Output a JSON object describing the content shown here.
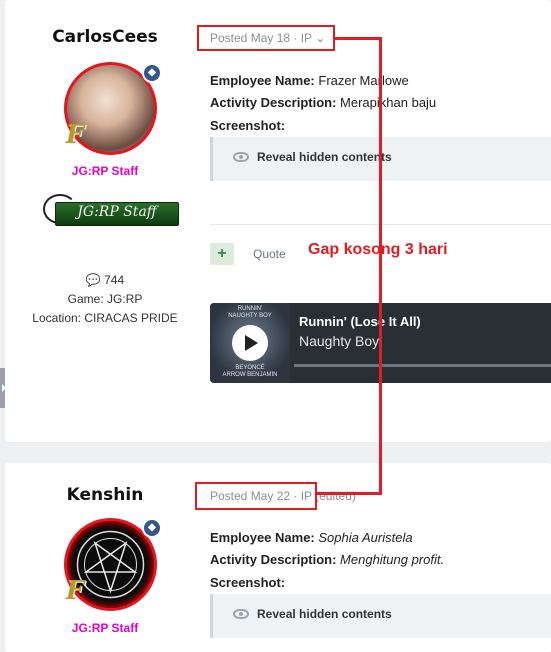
{
  "posts": [
    {
      "username": "CarlosCees",
      "rank_label": "JG:RP Staff",
      "staff_banner": "JG:RP Staff",
      "comment_count": "744",
      "game": "Game: JG:RP",
      "location": "Location: CIRACAS PRIDE",
      "posted": "Posted May 18 · IP",
      "employee_label": "Employee Name:",
      "employee_value": "Frazer Marlowe",
      "activity_label": "Activity Description:",
      "activity_value": "Merapikhan baju",
      "screenshot_label": "Screenshot:",
      "hidden_text": "Reveal hidden contents",
      "plus": "+",
      "quote": "Quote",
      "player": {
        "title": "Runnin' (Lose It All)",
        "artist": "Naughty Boy",
        "cover_top": "RUNNIN'",
        "cover_mid": "NAUGHTY BOY",
        "cover_bot1": "BEYONCÉ",
        "cover_bot2": "ARROW BENJAMIN"
      }
    },
    {
      "username": "Kenshin",
      "rank_label": "JG:RP Staff",
      "posted": "Posted May 22 · IP",
      "edited": "(edited)",
      "employee_label": "Employee Name:",
      "employee_value": "Sophia Auristela",
      "activity_label": "Activity Description:",
      "activity_value": "Menghitung profit.",
      "screenshot_label": "Screenshot:",
      "hidden_text": "Reveal hidden contents"
    }
  ],
  "annotation": {
    "text": "Gap kosong 3 hari",
    "color": "#e11d23"
  },
  "icons": {
    "shield": "shield-icon",
    "eye": "eye-icon",
    "comment": "comment-icon",
    "play": "play-icon",
    "chevron": "chevron-down-icon"
  }
}
